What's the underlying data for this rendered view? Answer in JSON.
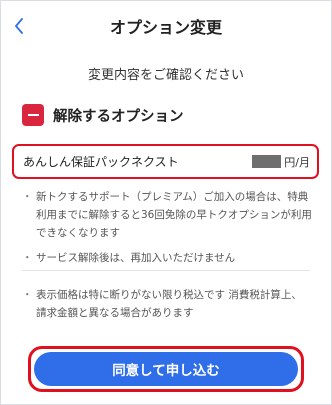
{
  "header": {
    "title": "オプション変更",
    "back_icon": "chevron-left-icon"
  },
  "lead": "変更内容をご確認ください",
  "section": {
    "icon": "minus-square-icon",
    "title": "解除するオプション"
  },
  "option": {
    "name": "あんしん保証パックネクスト",
    "price_unit": "円/月"
  },
  "notes": [
    "新トクするサポート（プレミアム）ご加入の場合は、特典利用までに解除すると36回免除の早トクオプションが利用できなくなります",
    "サービス解除後は、再加入いただけません"
  ],
  "notes2": [
    "表示価格は特に断りがない限り税込です 消費税計算上、請求金額と異なる場合があります"
  ],
  "cta": {
    "label": "同意して申し込む"
  },
  "colors": {
    "accent_blue": "#2f6ee8",
    "highlight_red": "#e0101f",
    "badge_red": "#d9253d"
  }
}
